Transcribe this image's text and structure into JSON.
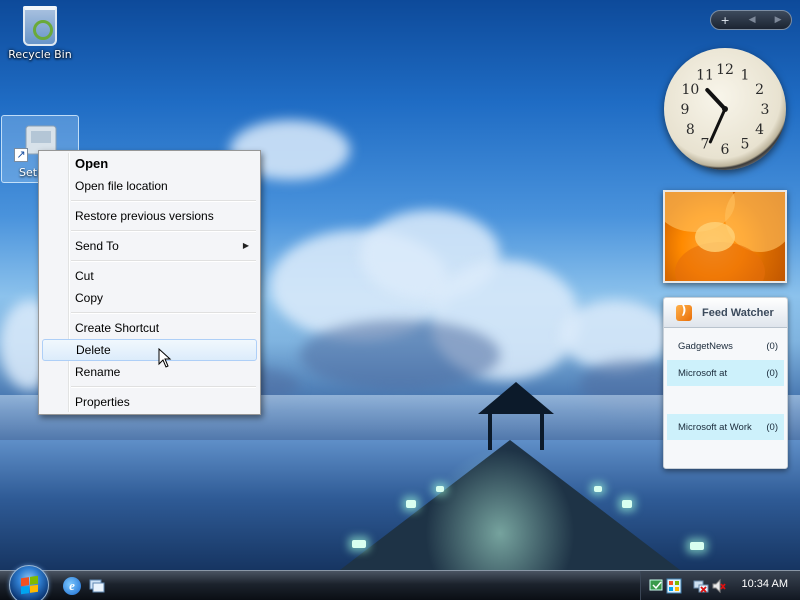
{
  "desktop": {
    "icons": [
      {
        "label": "Recycle Bin",
        "icon": "recycle-bin-icon"
      },
      {
        "label": "Setu",
        "icon": "setup-shortcut-icon"
      }
    ]
  },
  "context_menu": {
    "items": [
      {
        "label": "Open",
        "bold": true
      },
      {
        "label": "Open file location"
      },
      {
        "separator": true
      },
      {
        "label": "Restore previous versions"
      },
      {
        "separator": true
      },
      {
        "label": "Send To",
        "submenu": true
      },
      {
        "separator": true
      },
      {
        "label": "Cut"
      },
      {
        "label": "Copy"
      },
      {
        "separator": true
      },
      {
        "label": "Create Shortcut"
      },
      {
        "label": "Delete",
        "highlighted": true
      },
      {
        "label": "Rename"
      },
      {
        "separator": true
      },
      {
        "label": "Properties"
      }
    ],
    "submenu_arrow": "▶"
  },
  "sidebar": {
    "controls": {
      "add": "+",
      "prev": "◀",
      "next": "▶"
    },
    "clock": {
      "hour": 10,
      "minute": 34,
      "numerals": [
        "12",
        "1",
        "2",
        "3",
        "4",
        "5",
        "6",
        "7",
        "8",
        "9",
        "10",
        "11"
      ]
    },
    "feed_watcher": {
      "title": "Feed Watcher",
      "rows": [
        {
          "name": "GadgetNews",
          "count": "(0)",
          "highlight": false
        },
        {
          "name": "Microsoft at",
          "count": "(0)",
          "highlight": true
        },
        {
          "name": "",
          "count": "",
          "highlight": false
        },
        {
          "name": "Microsoft at Work",
          "count": "(0)",
          "highlight": true
        },
        {
          "name": "",
          "count": "",
          "highlight": false
        }
      ]
    }
  },
  "taskbar": {
    "quick_launch": [
      {
        "icon": "internet-explorer-icon",
        "glyph": "e"
      },
      {
        "icon": "switch-windows-icon"
      }
    ],
    "clock": "10:34 AM"
  },
  "colors": {
    "menu_bg": "#f4f5f8",
    "menu_highlight": "#dcecfb",
    "feed_highlight": "#cdf1fb",
    "flag": [
      "#f25022",
      "#7fba00",
      "#00a4ef",
      "#ffb900"
    ]
  }
}
